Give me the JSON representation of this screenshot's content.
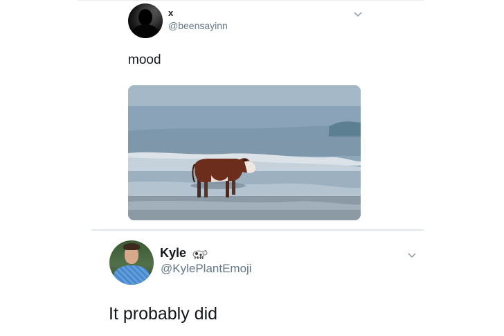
{
  "tweets": [
    {
      "name": "x",
      "handle": "@beensayinn",
      "text": "mood",
      "avatar_icon": "silhouette-avatar",
      "media_icon": "cow-on-beach-photo"
    },
    {
      "name": "Kyle",
      "name_emoji_icon": "cow-emoji",
      "handle": "@KylePlantEmoji",
      "text": "It probably did",
      "avatar_icon": "man-avatar"
    }
  ],
  "colors": {
    "text_primary": "#14171a",
    "text_secondary": "#657786",
    "divider": "#e1e6ea"
  }
}
